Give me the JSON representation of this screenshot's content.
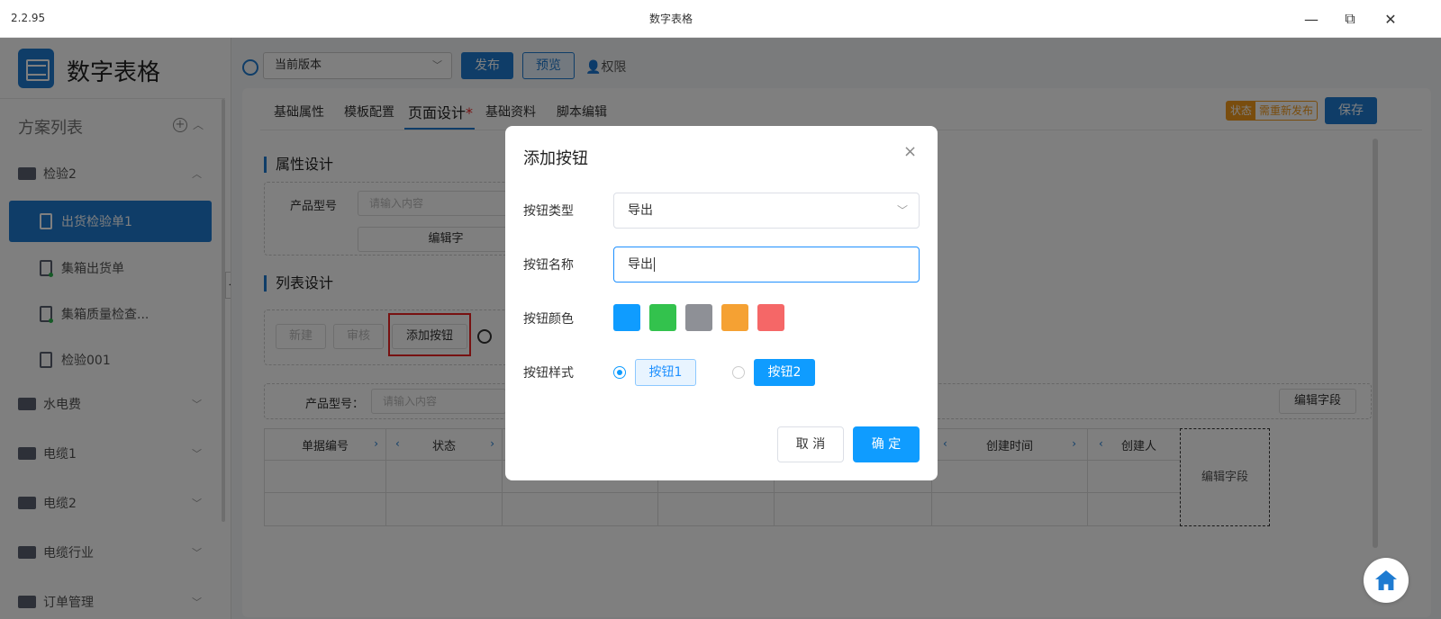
{
  "window": {
    "version": "2.2.95",
    "title": "数字表格",
    "minimize": "—",
    "restore": "⧉",
    "close": "✕"
  },
  "sidebar": {
    "app_name": "数字表格",
    "list_title": "方案列表",
    "groups": [
      {
        "label": "检验2",
        "expanded": true
      },
      {
        "label": "水电费"
      },
      {
        "label": "电缆1"
      },
      {
        "label": "电缆2"
      },
      {
        "label": "电缆行业"
      },
      {
        "label": "订单管理"
      }
    ],
    "docs": [
      {
        "label": "出货检验单1",
        "active": true
      },
      {
        "label": "集箱出货单"
      },
      {
        "label": "集箱质量检查..."
      },
      {
        "label": "检验001"
      }
    ]
  },
  "toolbar": {
    "version": "当前版本",
    "publish": "发布",
    "preview": "预览",
    "permission": "权限"
  },
  "tabs": [
    {
      "label": "基础属性"
    },
    {
      "label": "模板配置"
    },
    {
      "label": "页面设计",
      "active": true
    },
    {
      "label": "基础资料"
    },
    {
      "label": "脚本编辑"
    }
  ],
  "status": {
    "key": "状态",
    "value": "需重新发布"
  },
  "save": "保存",
  "attr_section": {
    "title": "属性设计",
    "field_label": "产品型号",
    "placeholder": "请输入内容",
    "edit": "编辑字"
  },
  "list_section": {
    "title": "列表设计",
    "buttons": [
      "新建",
      "审核",
      "添加按钮"
    ],
    "filter_label": "产品型号：",
    "filter_placeholder": "请输入内容",
    "edit_field": "编辑字段",
    "columns": [
      "单据编号",
      "状态",
      "创建时间",
      "创建人"
    ],
    "grid_edit": "编辑字段"
  },
  "modal": {
    "title": "添加按钮",
    "close": "×",
    "type_label": "按钮类型",
    "type_value": "导出",
    "name_label": "按钮名称",
    "name_value": "导出",
    "color_label": "按钮颜色",
    "colors": [
      "#0f9cff",
      "#33c24d",
      "#8e9096",
      "#f5a133",
      "#f56767"
    ],
    "style_label": "按钮样式",
    "style1": "按钮1",
    "style2": "按钮2",
    "selected_style": "按钮1",
    "cancel": "取 消",
    "ok": "确 定"
  }
}
